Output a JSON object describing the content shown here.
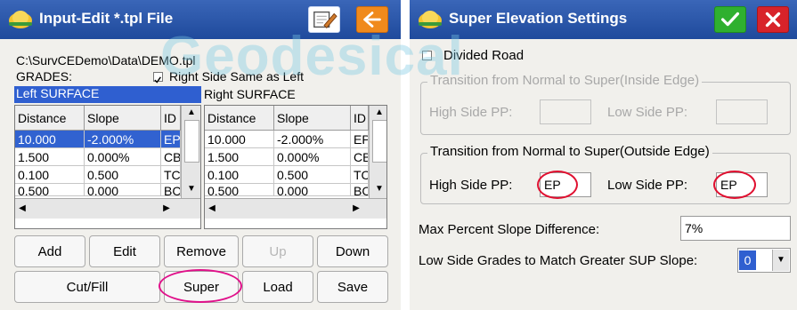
{
  "left_window": {
    "title": "Input-Edit *.tpl File",
    "path": "C:\\SurvCEDemo\\Data\\DEMO.tpl",
    "grades_label": "GRADES:",
    "right_same_label": "Right Side Same as Left",
    "right_same_checked": true,
    "left_surface_label": "Left SURFACE",
    "right_surface_label": "Right SURFACE",
    "left_table": {
      "headers": [
        "Distance",
        "Slope",
        "ID"
      ],
      "rows": [
        [
          "10.000",
          "-2.000%",
          "EP"
        ],
        [
          "1.500",
          "0.000%",
          "CB"
        ],
        [
          "0.100",
          "0.500",
          "TC"
        ],
        [
          "0.500",
          "0.000",
          "BC"
        ]
      ]
    },
    "right_table": {
      "headers": [
        "Distance",
        "Slope",
        "ID"
      ],
      "rows": [
        [
          "10.000",
          "-2.000%",
          "EP"
        ],
        [
          "1.500",
          "0.000%",
          "CB"
        ],
        [
          "0.100",
          "0.500",
          "TC"
        ],
        [
          "0.500",
          "0.000",
          "BC"
        ]
      ]
    },
    "buttons_row1": [
      "Add",
      "Edit",
      "Remove",
      "Up",
      "Down"
    ],
    "buttons_row2": [
      "Cut/Fill",
      "Super",
      "Load",
      "Save"
    ]
  },
  "right_window": {
    "title": "Super Elevation Settings",
    "divided_road_label": "Divided Road",
    "divided_road_checked": false,
    "inside_group_label": "Transition from Normal to Super(Inside Edge)",
    "inside_high_label": "High Side PP:",
    "inside_low_label": "Low Side PP:",
    "inside_high_value": "",
    "inside_low_value": "",
    "outside_group_label": "Transition from Normal to Super(Outside Edge)",
    "outside_high_label": "High Side PP:",
    "outside_low_label": "Low Side PP:",
    "outside_high_value": "EP",
    "outside_low_value": "EP",
    "max_slope_label": "Max Percent Slope Difference:",
    "max_slope_value": "7%",
    "low_grades_label": "Low Side Grades to Match Greater SUP Slope:",
    "low_grades_value": "0"
  },
  "watermark": "Geodesical",
  "colors": {
    "titlebar": "#2451a8",
    "selection": "#3162d0",
    "ok_green": "#2fb02f",
    "cancel_red": "#d8232a",
    "back_orange": "#f08a1c",
    "highlight_ring_red": "#e01030",
    "highlight_ring_magenta": "#e0108a"
  },
  "icons": {
    "app_logo": "surveyor-helmet-icon",
    "edit_button": "notepad-pencil-icon",
    "back_button": "left-arrow-icon",
    "ok_button": "checkmark-icon",
    "cancel_button": "x-close-icon"
  }
}
